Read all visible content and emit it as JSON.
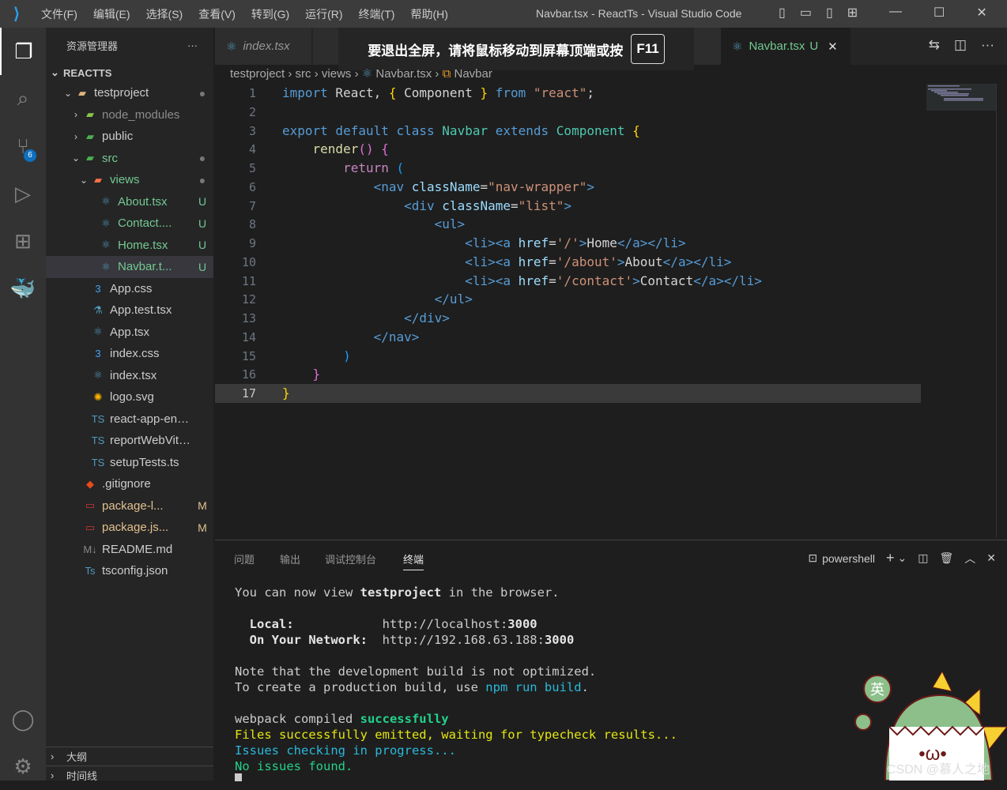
{
  "menu": [
    "文件(F)",
    "编辑(E)",
    "选择(S)",
    "查看(V)",
    "转到(G)",
    "运行(R)",
    "终端(T)",
    "帮助(H)"
  ],
  "window_title": "Navbar.tsx - ReactTs - Visual Studio Code",
  "scm_badge": "6",
  "sidebar": {
    "title": "资源管理器",
    "more": "···",
    "section": "REACTTS",
    "items": [
      {
        "name": "testproject",
        "icon": "folder",
        "color": "#ccc",
        "status": "●",
        "level": 0,
        "chev": "⌄"
      },
      {
        "name": "node_modules",
        "icon": "folder-node",
        "color": "#8c8c8c",
        "status": "",
        "level": 1,
        "chev": "›"
      },
      {
        "name": "public",
        "icon": "folder-public",
        "color": "#ccc",
        "status": "",
        "level": 1,
        "chev": "›"
      },
      {
        "name": "src",
        "icon": "folder-src",
        "color": "#73c991",
        "status": "●",
        "level": 1,
        "chev": "⌄"
      },
      {
        "name": "views",
        "icon": "folder-views",
        "color": "#73c991",
        "status": "●",
        "level": 2,
        "chev": "⌄"
      },
      {
        "name": "About.tsx",
        "icon": "react",
        "color": "#73c991",
        "status": "U",
        "level": 3
      },
      {
        "name": "Contact....",
        "icon": "react",
        "color": "#73c991",
        "status": "U",
        "level": 3
      },
      {
        "name": "Home.tsx",
        "icon": "react",
        "color": "#73c991",
        "status": "U",
        "level": 3
      },
      {
        "name": "Navbar.t...",
        "icon": "react",
        "color": "#73c991",
        "status": "U",
        "level": 3,
        "selected": true
      },
      {
        "name": "App.css",
        "icon": "css",
        "color": "#ccc",
        "status": "",
        "level": 2
      },
      {
        "name": "App.test.tsx",
        "icon": "test",
        "color": "#ccc",
        "status": "",
        "level": 2
      },
      {
        "name": "App.tsx",
        "icon": "react",
        "color": "#ccc",
        "status": "",
        "level": 2
      },
      {
        "name": "index.css",
        "icon": "css",
        "color": "#ccc",
        "status": "",
        "level": 2
      },
      {
        "name": "index.tsx",
        "icon": "react",
        "color": "#ccc",
        "status": "",
        "level": 2
      },
      {
        "name": "logo.svg",
        "icon": "svg",
        "color": "#ccc",
        "status": "",
        "level": 2
      },
      {
        "name": "react-app-env....",
        "icon": "ts",
        "color": "#ccc",
        "status": "",
        "level": 2
      },
      {
        "name": "reportWebVital...",
        "icon": "ts",
        "color": "#ccc",
        "status": "",
        "level": 2
      },
      {
        "name": "setupTests.ts",
        "icon": "ts",
        "color": "#ccc",
        "status": "",
        "level": 2
      },
      {
        "name": ".gitignore",
        "icon": "git",
        "color": "#ccc",
        "status": "",
        "level": 1
      },
      {
        "name": "package-l...",
        "icon": "npm",
        "color": "#e2c08d",
        "status": "M",
        "level": 1
      },
      {
        "name": "package.js...",
        "icon": "npm",
        "color": "#e2c08d",
        "status": "M",
        "level": 1
      },
      {
        "name": "README.md",
        "icon": "md",
        "color": "#ccc",
        "status": "",
        "level": 1
      },
      {
        "name": "tsconfig.json",
        "icon": "tsconfig",
        "color": "#ccc",
        "status": "",
        "level": 1
      }
    ],
    "outline": "大纲",
    "timeline": "时间线"
  },
  "tabs": [
    {
      "label": "index.tsx",
      "italic": true
    },
    {
      "label": "Navbar.tsx",
      "status": "U",
      "close": "✕",
      "active": true
    }
  ],
  "fullscreen_hint": {
    "text": "要退出全屏，请将鼠标移动到屏幕顶端或按",
    "key": "F11"
  },
  "breadcrumb": [
    "testproject",
    "src",
    "views",
    "Navbar.tsx",
    "Navbar"
  ],
  "code": [
    [
      [
        "import",
        "kw"
      ],
      [
        " React, ",
        "txt"
      ],
      [
        "{",
        "br1"
      ],
      [
        " Component ",
        "txt"
      ],
      [
        "}",
        "br1"
      ],
      [
        " from ",
        "kw"
      ],
      [
        "\"react\"",
        "str"
      ],
      [
        ";",
        "txt"
      ]
    ],
    [],
    [
      [
        "export default class ",
        "kw"
      ],
      [
        "Navbar ",
        "cls"
      ],
      [
        "extends ",
        "kw"
      ],
      [
        "Component ",
        "cls"
      ],
      [
        "{",
        "br1"
      ]
    ],
    [
      [
        "    "
      ],
      [
        "render",
        "fn"
      ],
      [
        "()",
        "br2"
      ],
      [
        " ",
        "txt"
      ],
      [
        "{",
        "br2"
      ]
    ],
    [
      [
        "        "
      ],
      [
        "return ",
        "ctl"
      ],
      [
        "(",
        "br3"
      ]
    ],
    [
      [
        "            "
      ],
      [
        "<nav ",
        "tag"
      ],
      [
        "className",
        "attr"
      ],
      [
        "=",
        "txt"
      ],
      [
        "\"nav-wrapper\"",
        "str"
      ],
      [
        ">",
        "tag"
      ]
    ],
    [
      [
        "                "
      ],
      [
        "<div ",
        "tag"
      ],
      [
        "className",
        "attr"
      ],
      [
        "=",
        "txt"
      ],
      [
        "\"list\"",
        "str"
      ],
      [
        ">",
        "tag"
      ]
    ],
    [
      [
        "                    "
      ],
      [
        "<ul>",
        "tag"
      ]
    ],
    [
      [
        "                        "
      ],
      [
        "<li><a ",
        "tag"
      ],
      [
        "href",
        "attr"
      ],
      [
        "=",
        "txt"
      ],
      [
        "'/'",
        "str"
      ],
      [
        ">",
        "tag"
      ],
      [
        "Home",
        "txt"
      ],
      [
        "</a></li>",
        "tag"
      ]
    ],
    [
      [
        "                        "
      ],
      [
        "<li><a ",
        "tag"
      ],
      [
        "href",
        "attr"
      ],
      [
        "=",
        "txt"
      ],
      [
        "'/about'",
        "str"
      ],
      [
        ">",
        "tag"
      ],
      [
        "About",
        "txt"
      ],
      [
        "</a></li>",
        "tag"
      ]
    ],
    [
      [
        "                        "
      ],
      [
        "<li><a ",
        "tag"
      ],
      [
        "href",
        "attr"
      ],
      [
        "=",
        "txt"
      ],
      [
        "'/contact'",
        "str"
      ],
      [
        ">",
        "tag"
      ],
      [
        "Contact",
        "txt"
      ],
      [
        "</a></li>",
        "tag"
      ]
    ],
    [
      [
        "                    "
      ],
      [
        "</ul>",
        "tag"
      ]
    ],
    [
      [
        "                "
      ],
      [
        "</div>",
        "tag"
      ]
    ],
    [
      [
        "            "
      ],
      [
        "</nav>",
        "tag"
      ]
    ],
    [
      [
        "        "
      ],
      [
        ")",
        "br3"
      ]
    ],
    [
      [
        "    "
      ],
      [
        "}",
        "br2"
      ]
    ],
    [
      [
        "}",
        "br1"
      ]
    ]
  ],
  "panel": {
    "tabs": [
      "问题",
      "输出",
      "调试控制台",
      "终端"
    ],
    "shell": "powershell"
  },
  "terminal": [
    [
      [
        "You can now view ",
        ""
      ],
      [
        "testproject",
        "b"
      ],
      [
        " in the browser.",
        ""
      ]
    ],
    [],
    [
      [
        "  ",
        ""
      ],
      [
        "Local:",
        "b"
      ],
      [
        "            http://localhost:",
        ""
      ],
      [
        "3000",
        "b"
      ]
    ],
    [
      [
        "  ",
        ""
      ],
      [
        "On Your Network:",
        "b"
      ],
      [
        "  http://192.168.63.188:",
        ""
      ],
      [
        "3000",
        "b"
      ]
    ],
    [],
    [
      [
        "Note that the development build is not optimized.",
        ""
      ]
    ],
    [
      [
        "To create a production build, use ",
        ""
      ],
      [
        "npm run build",
        "cy"
      ],
      [
        ".",
        ""
      ]
    ],
    [],
    [
      [
        "webpack compiled ",
        ""
      ],
      [
        "successfully",
        "gb"
      ]
    ],
    [
      [
        "Files successfully emitted, waiting for typecheck results...",
        "gy"
      ]
    ],
    [
      [
        "Issues checking in progress...",
        "cy"
      ]
    ],
    [
      [
        "No issues found.",
        "g"
      ]
    ]
  ],
  "ime_badge": "英",
  "watermark": "CSDN @慕人之地"
}
